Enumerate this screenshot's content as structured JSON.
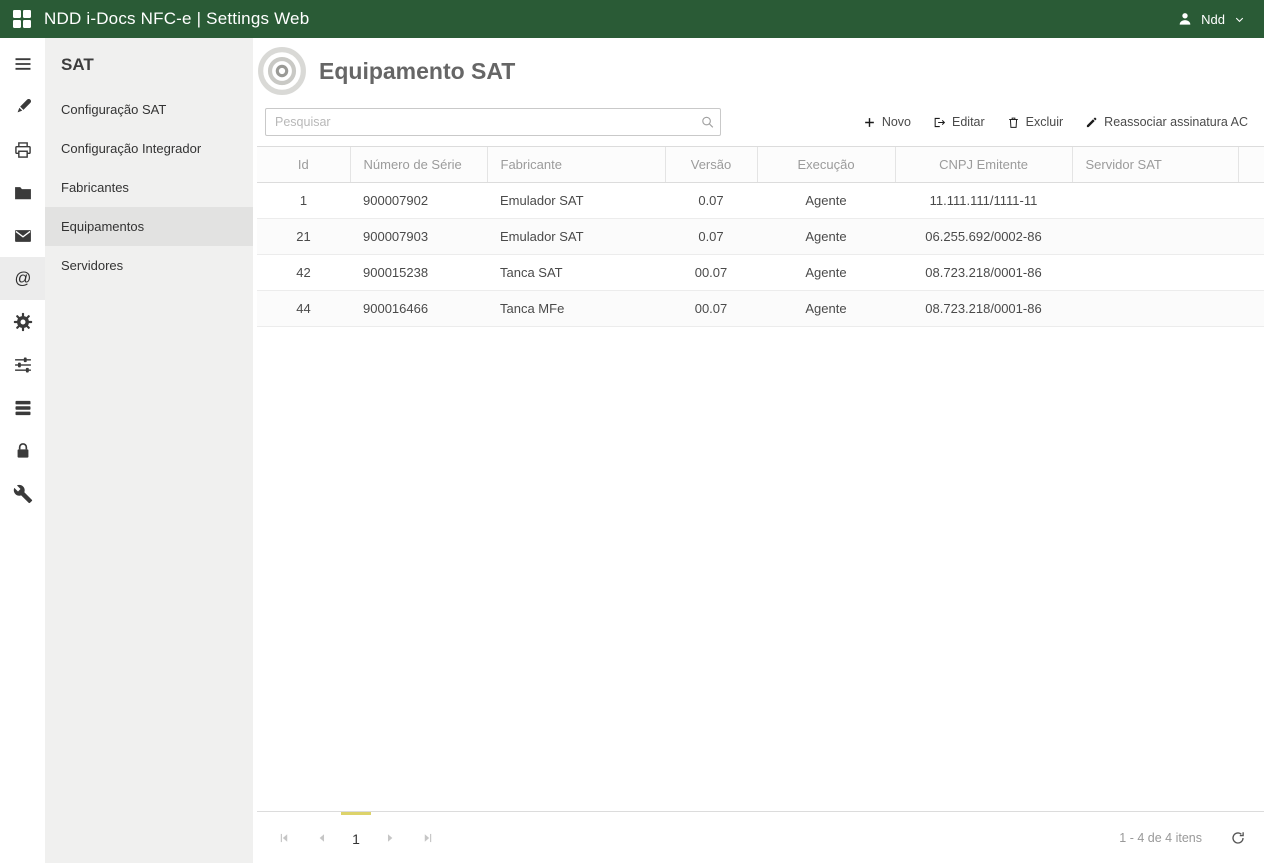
{
  "topbar": {
    "title": "NDD i-Docs NFC-e | Settings Web",
    "user_name": "Ndd"
  },
  "rail": {
    "items": [
      {
        "icon": "menu-icon",
        "selected": false
      },
      {
        "icon": "brush-icon",
        "selected": false
      },
      {
        "icon": "printer-icon",
        "selected": false
      },
      {
        "icon": "folder-icon",
        "selected": false
      },
      {
        "icon": "mail-icon",
        "selected": false
      },
      {
        "icon": "at-icon",
        "selected": true
      },
      {
        "icon": "gear-icon",
        "selected": false
      },
      {
        "icon": "sliders-icon",
        "selected": false
      },
      {
        "icon": "server-icon",
        "selected": false
      },
      {
        "icon": "lock-icon",
        "selected": false
      },
      {
        "icon": "wrench-icon",
        "selected": false
      }
    ]
  },
  "sidebar": {
    "title": "SAT",
    "items": [
      {
        "label": "Configuração SAT",
        "selected": false
      },
      {
        "label": "Configuração Integrador",
        "selected": false
      },
      {
        "label": "Fabricantes",
        "selected": false
      },
      {
        "label": "Equipamentos",
        "selected": true
      },
      {
        "label": "Servidores",
        "selected": false
      }
    ]
  },
  "main": {
    "title": "Equipamento SAT",
    "search": {
      "placeholder": "Pesquisar"
    },
    "toolbar": {
      "new_label": "Novo",
      "edit_label": "Editar",
      "delete_label": "Excluir",
      "reassign_label": "Reassociar assinatura AC"
    },
    "table": {
      "columns": [
        "Id",
        "Número de Série",
        "Fabricante",
        "Versão",
        "Execução",
        "CNPJ Emitente",
        "Servidor SAT"
      ],
      "rows": [
        [
          "1",
          "900007902",
          "Emulador SAT",
          "0.07",
          "Agente",
          "11.111.111/1111-11",
          ""
        ],
        [
          "21",
          "900007903",
          "Emulador SAT",
          "0.07",
          "Agente",
          "06.255.692/0002-86",
          ""
        ],
        [
          "42",
          "900015238",
          "Tanca SAT",
          "00.07",
          "Agente",
          "08.723.218/0001-86",
          ""
        ],
        [
          "44",
          "900016466",
          "Tanca MFe",
          "00.07",
          "Agente",
          "08.723.218/0001-86",
          ""
        ]
      ]
    },
    "pager": {
      "current_page": "1",
      "info": "1 - 4 de 4 itens"
    }
  },
  "colors": {
    "topbar_green": "#2a5b36",
    "accent_yellow": "#ddd36b"
  }
}
